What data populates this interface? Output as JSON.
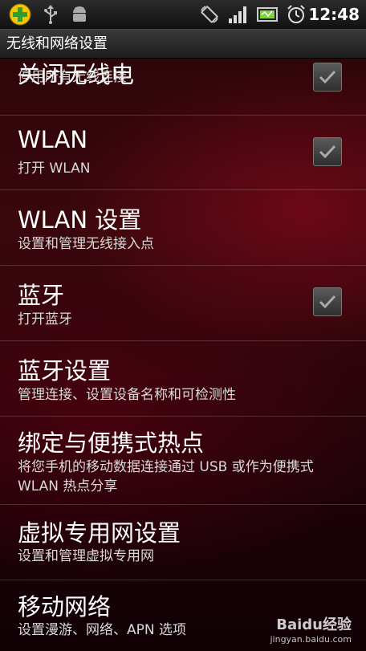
{
  "status_bar": {
    "clock": "12:48",
    "icons": [
      "app-add-icon",
      "usb-icon",
      "android-debug-icon",
      "rotate-icon",
      "signal-icon",
      "battery-icon",
      "alarm-icon"
    ]
  },
  "title_bar": {
    "title": "无线和网络设置"
  },
  "settings": [
    {
      "title": "关闭无线电",
      "summary": "停用所有无线连接",
      "checkbox": true,
      "checked": true
    },
    {
      "title": "WLAN",
      "summary": "打开 WLAN",
      "checkbox": true,
      "checked": true
    },
    {
      "title": "WLAN 设置",
      "summary": "设置和管理无线接入点",
      "checkbox": false
    },
    {
      "title": "蓝牙",
      "summary": "打开蓝牙",
      "checkbox": true,
      "checked": true
    },
    {
      "title": "蓝牙设置",
      "summary": "管理连接、设置设备名称和可检测性",
      "checkbox": false
    },
    {
      "title": "绑定与便携式热点",
      "summary": "将您手机的移动数据连接通过 USB 或作为便携式 WLAN 热点分享",
      "checkbox": false
    },
    {
      "title": "虚拟专用网设置",
      "summary": "设置和管理虚拟专用网",
      "checkbox": false
    },
    {
      "title": "移动网络",
      "summary": "设置漫游、网络、APN 选项",
      "checkbox": false
    }
  ],
  "watermark": {
    "logo": "Baidu经验",
    "url": "jingyan.baidu.com"
  },
  "colors": {
    "background": "#3a070d",
    "text_primary": "#ffffff",
    "text_secondary": "#d9d9d9",
    "status_bar": "#1a1a1a"
  }
}
